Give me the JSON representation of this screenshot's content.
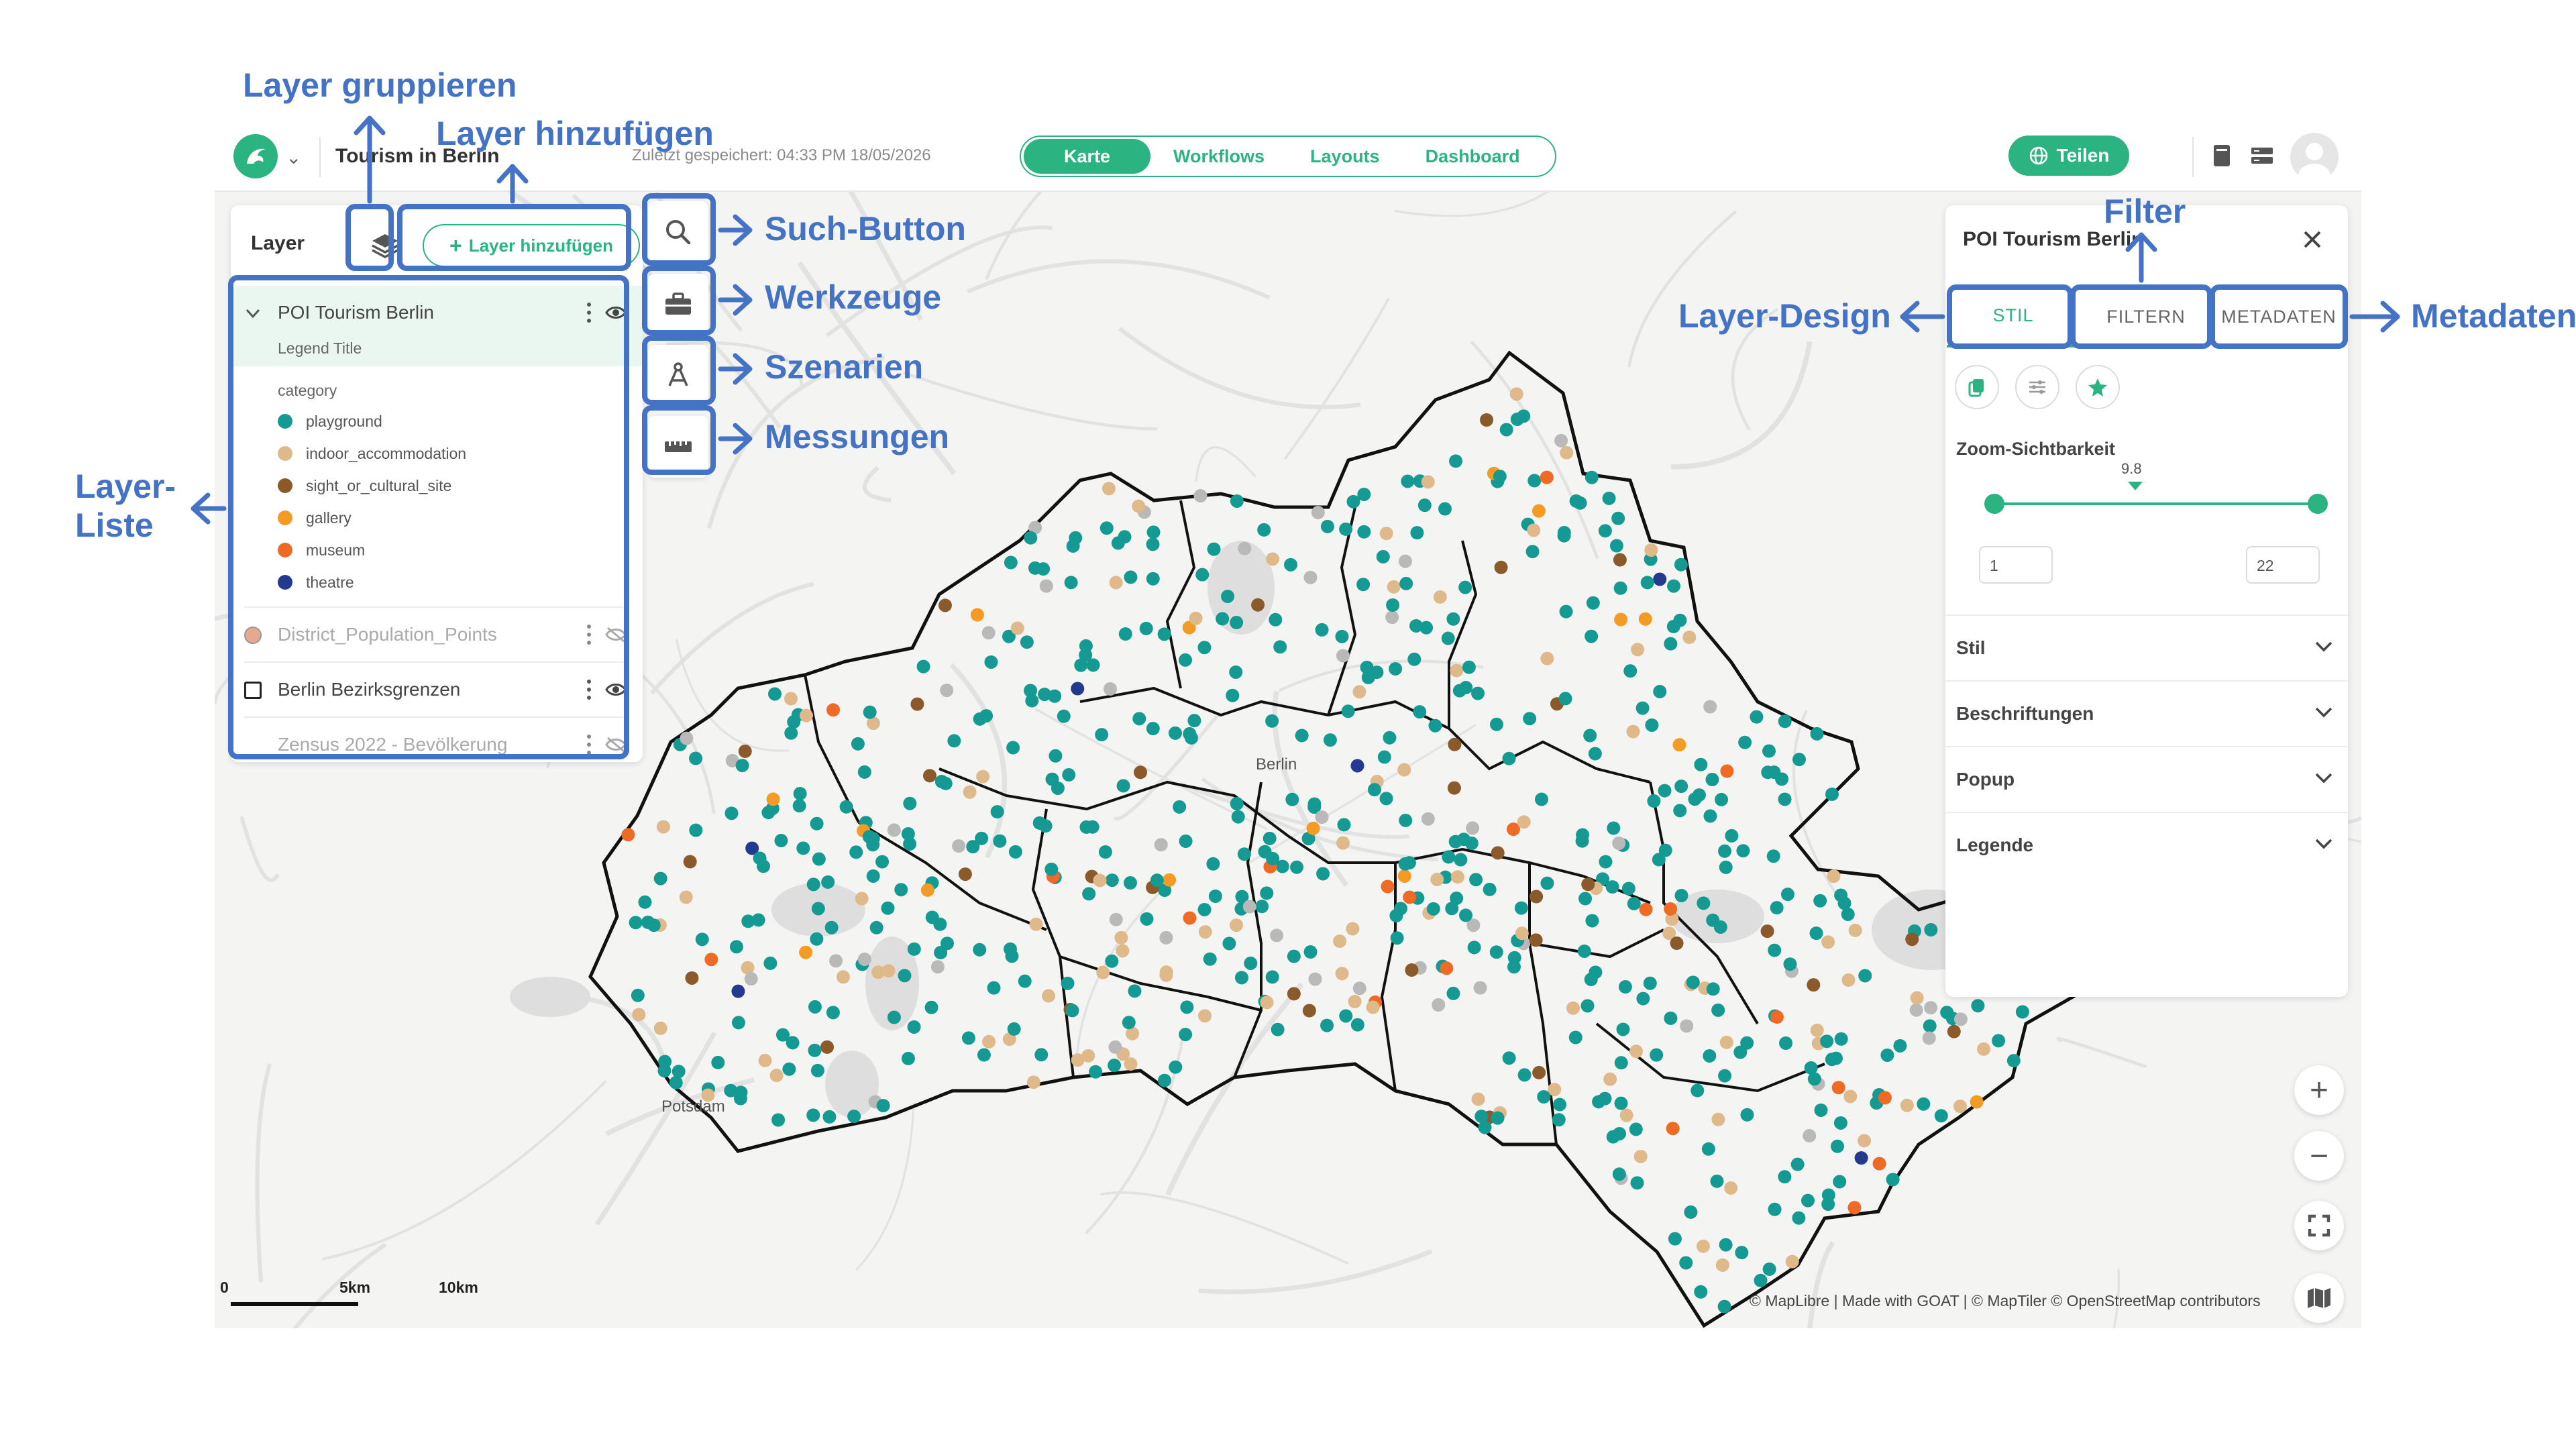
{
  "header": {
    "project_title": "Tourism in Berlin",
    "saved_label": "Zuletzt gespeichert: 04:33 PM 18/05/2026",
    "tabs": [
      {
        "label": "Karte",
        "active": true
      },
      {
        "label": "Workflows",
        "active": false
      },
      {
        "label": "Layouts",
        "active": false
      },
      {
        "label": "Dashboard",
        "active": false
      }
    ],
    "share_label": "Teilen",
    "icons": [
      "logo-icon",
      "chevron-down-icon",
      "book-icon",
      "storage-icon",
      "avatar-icon"
    ]
  },
  "layer_panel": {
    "title": "Layer",
    "add_label": "Layer hinzufügen",
    "layers": [
      {
        "name": "POI Tourism Berlin",
        "visible": true,
        "expanded": true
      },
      {
        "name": "District_Population_Points",
        "visible": false
      },
      {
        "name": "Berlin Bezirksgrenzen",
        "visible": true
      },
      {
        "name": "Zensus 2022 - Bevölkerung",
        "visible": false
      }
    ],
    "legend": {
      "title": "Legend Title",
      "field": "category",
      "items": [
        {
          "label": "playground",
          "color": "#159a93"
        },
        {
          "label": "indoor_accommodation",
          "color": "#dfb98a"
        },
        {
          "label": "sight_or_cultural_site",
          "color": "#8b5a2b"
        },
        {
          "label": "gallery",
          "color": "#f49b26"
        },
        {
          "label": "museum",
          "color": "#ee6a25"
        },
        {
          "label": "theatre",
          "color": "#233a8f"
        }
      ]
    }
  },
  "map": {
    "city_labels": {
      "berlin": "Berlin",
      "potsdam": "Potsdam"
    },
    "scale": {
      "start": "0",
      "mid": "5km",
      "end": "10km"
    },
    "attribution": "© MapLibre | Made with GOAT | © MapTiler © OpenStreetMap contributors",
    "tools": [
      "search-icon",
      "toolbox-icon",
      "scenario-icon",
      "ruler-icon"
    ],
    "controls": {
      "zoom_in": "+",
      "zoom_out": "−"
    }
  },
  "properties_panel": {
    "title": "POI Tourism Berlin",
    "tabs": [
      {
        "label": "STIL",
        "active": true
      },
      {
        "label": "FILTERN",
        "active": false
      },
      {
        "label": "METADATEN",
        "active": false
      }
    ],
    "zoom_label": "Zoom-Sichtbarkeit",
    "zoom_current": "9.8",
    "zoom_min": "1",
    "zoom_max": "22",
    "sections": [
      "Stil",
      "Beschriftungen",
      "Popup",
      "Legende"
    ]
  },
  "annotations": {
    "layer_group": "Layer gruppieren",
    "layer_add": "Layer hinzufügen",
    "search": "Such-Button",
    "tools": "Werkzeuge",
    "scenarios": "Szenarien",
    "measure": "Messungen",
    "filter": "Filter",
    "layer_design": "Layer-Design",
    "metadata": "Metadaten",
    "layer_list_1": "Layer-",
    "layer_list_2": "Liste"
  },
  "colors": {
    "accent": "#2bb381",
    "annotation": "#4472c4"
  }
}
